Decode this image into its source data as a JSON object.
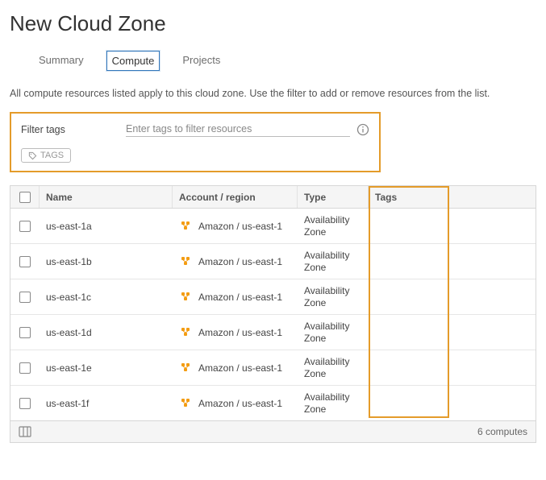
{
  "page_title": "New Cloud Zone",
  "tabs": {
    "summary": "Summary",
    "compute": "Compute",
    "projects": "Projects"
  },
  "description": "All compute resources listed apply to this cloud zone. Use the filter to add or remove resources from the list.",
  "filter": {
    "label": "Filter tags",
    "placeholder": "Enter tags to filter resources",
    "tags_button": "TAGS"
  },
  "columns": {
    "name": "Name",
    "account": "Account / region",
    "type": "Type",
    "tags": "Tags"
  },
  "rows": [
    {
      "name": "us-east-1a",
      "account": "Amazon / us-east-1",
      "type": "Availability Zone",
      "tags": ""
    },
    {
      "name": "us-east-1b",
      "account": "Amazon / us-east-1",
      "type": "Availability Zone",
      "tags": ""
    },
    {
      "name": "us-east-1c",
      "account": "Amazon / us-east-1",
      "type": "Availability Zone",
      "tags": ""
    },
    {
      "name": "us-east-1d",
      "account": "Amazon / us-east-1",
      "type": "Availability Zone",
      "tags": ""
    },
    {
      "name": "us-east-1e",
      "account": "Amazon / us-east-1",
      "type": "Availability Zone",
      "tags": ""
    },
    {
      "name": "us-east-1f",
      "account": "Amazon / us-east-1",
      "type": "Availability Zone",
      "tags": ""
    }
  ],
  "footer": {
    "count_label": "6 computes"
  }
}
